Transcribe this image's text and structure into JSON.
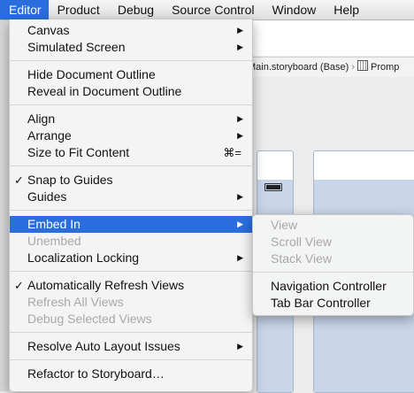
{
  "menubar": {
    "items": [
      "Editor",
      "Product",
      "Debug",
      "Source Control",
      "Window",
      "Help"
    ]
  },
  "background": {
    "breadcrumb": "Main.storyboard (Base)",
    "breadcrumb_next": "Promp"
  },
  "editor_menu": {
    "canvas": "Canvas",
    "simulated_screen": "Simulated Screen",
    "hide_outline": "Hide Document Outline",
    "reveal_outline": "Reveal in Document Outline",
    "align": "Align",
    "arrange": "Arrange",
    "size_to_fit": "Size to Fit Content",
    "size_to_fit_shortcut": "⌘=",
    "snap_to_guides": "Snap to Guides",
    "guides": "Guides",
    "embed_in": "Embed In",
    "unembed": "Unembed",
    "localization_locking": "Localization Locking",
    "auto_refresh": "Automatically Refresh Views",
    "refresh_all": "Refresh All Views",
    "debug_selected": "Debug Selected Views",
    "resolve_auto_layout": "Resolve Auto Layout Issues",
    "refactor_storyboard": "Refactor to Storyboard…",
    "checkmark": "✓",
    "arrow": "▶"
  },
  "embed_submenu": {
    "view": "View",
    "scroll_view": "Scroll View",
    "stack_view": "Stack View",
    "navigation_controller": "Navigation Controller",
    "tab_bar_controller": "Tab Bar Controller"
  },
  "colors": {
    "highlight": "#2a6ede",
    "disabled_text": "#a8a8a8"
  }
}
